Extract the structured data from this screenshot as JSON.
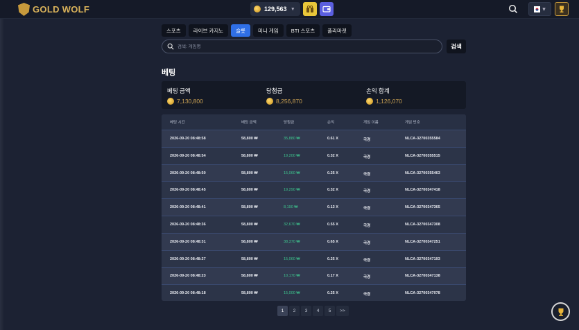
{
  "header": {
    "brand": "GOLD WOLF",
    "balance": "129,563"
  },
  "tabs": [
    {
      "label": "스포츠",
      "active": false
    },
    {
      "label": "라이브 카지노",
      "active": false
    },
    {
      "label": "슬롯",
      "active": true
    },
    {
      "label": "미니 게임",
      "active": false
    },
    {
      "label": "BTI 스포츠",
      "active": false
    },
    {
      "label": "폴리마켓",
      "active": false
    }
  ],
  "search": {
    "placeholder": "검색: 게임명",
    "button_label": "검색"
  },
  "section_title": "베팅",
  "summary": {
    "bet_label": "베팅 금액",
    "bet_value": "7,130,800",
    "win_label": "당첨금",
    "win_value": "8,256,870",
    "pnl_label": "손익 합계",
    "pnl_value": "1,126,070"
  },
  "table": {
    "headers": [
      "베팅 시간",
      "베팅 금액",
      "당첨금",
      "손익",
      "게임 이름",
      "게임 번호"
    ],
    "rows": [
      [
        "2026-09-20 08:48:58",
        "58,800 ₩",
        "35,880 ₩",
        "0.61 X",
        "극경",
        "NLCA-32700355584"
      ],
      [
        "2026-09-20 08:48:54",
        "58,800 ₩",
        "19,200 ₩",
        "0.32 X",
        "극경",
        "NLCA-32700355515"
      ],
      [
        "2026-09-20 08:48:50",
        "58,800 ₩",
        "15,060 ₩",
        "0.25 X",
        "극경",
        "NLCA-32700355463"
      ],
      [
        "2026-09-20 08:48:45",
        "58,800 ₩",
        "19,290 ₩",
        "0.32 X",
        "극경",
        "NLCA-32700347418"
      ],
      [
        "2026-09-20 08:48:41",
        "58,800 ₩",
        "8,190 ₩",
        "0.13 X",
        "극경",
        "NLCA-32700347365"
      ],
      [
        "2026-09-20 08:48:36",
        "58,800 ₩",
        "32,670 ₩",
        "0.55 X",
        "극경",
        "NLCA-32700347308"
      ],
      [
        "2026-09-20 08:48:31",
        "58,800 ₩",
        "38,370 ₩",
        "0.65 X",
        "극경",
        "NLCA-32700347251"
      ],
      [
        "2026-09-20 08:48:27",
        "58,800 ₩",
        "15,060 ₩",
        "0.25 X",
        "극경",
        "NLCA-32700347193"
      ],
      [
        "2026-09-20 08:48:23",
        "58,800 ₩",
        "10,170 ₩",
        "0.17 X",
        "극경",
        "NLCA-32700347138"
      ],
      [
        "2026-09-20 08:48:18",
        "58,800 ₩",
        "15,000 ₩",
        "0.25 X",
        "극경",
        "NLCA-32700347078"
      ]
    ]
  },
  "pagination": {
    "pages": [
      "1",
      "2",
      "3",
      "4",
      "5"
    ],
    "next": ">>",
    "current": "1"
  },
  "colors": {
    "accent": "#2f6fe6",
    "gold": "#c9a052",
    "win_green": "#3ec68e"
  }
}
